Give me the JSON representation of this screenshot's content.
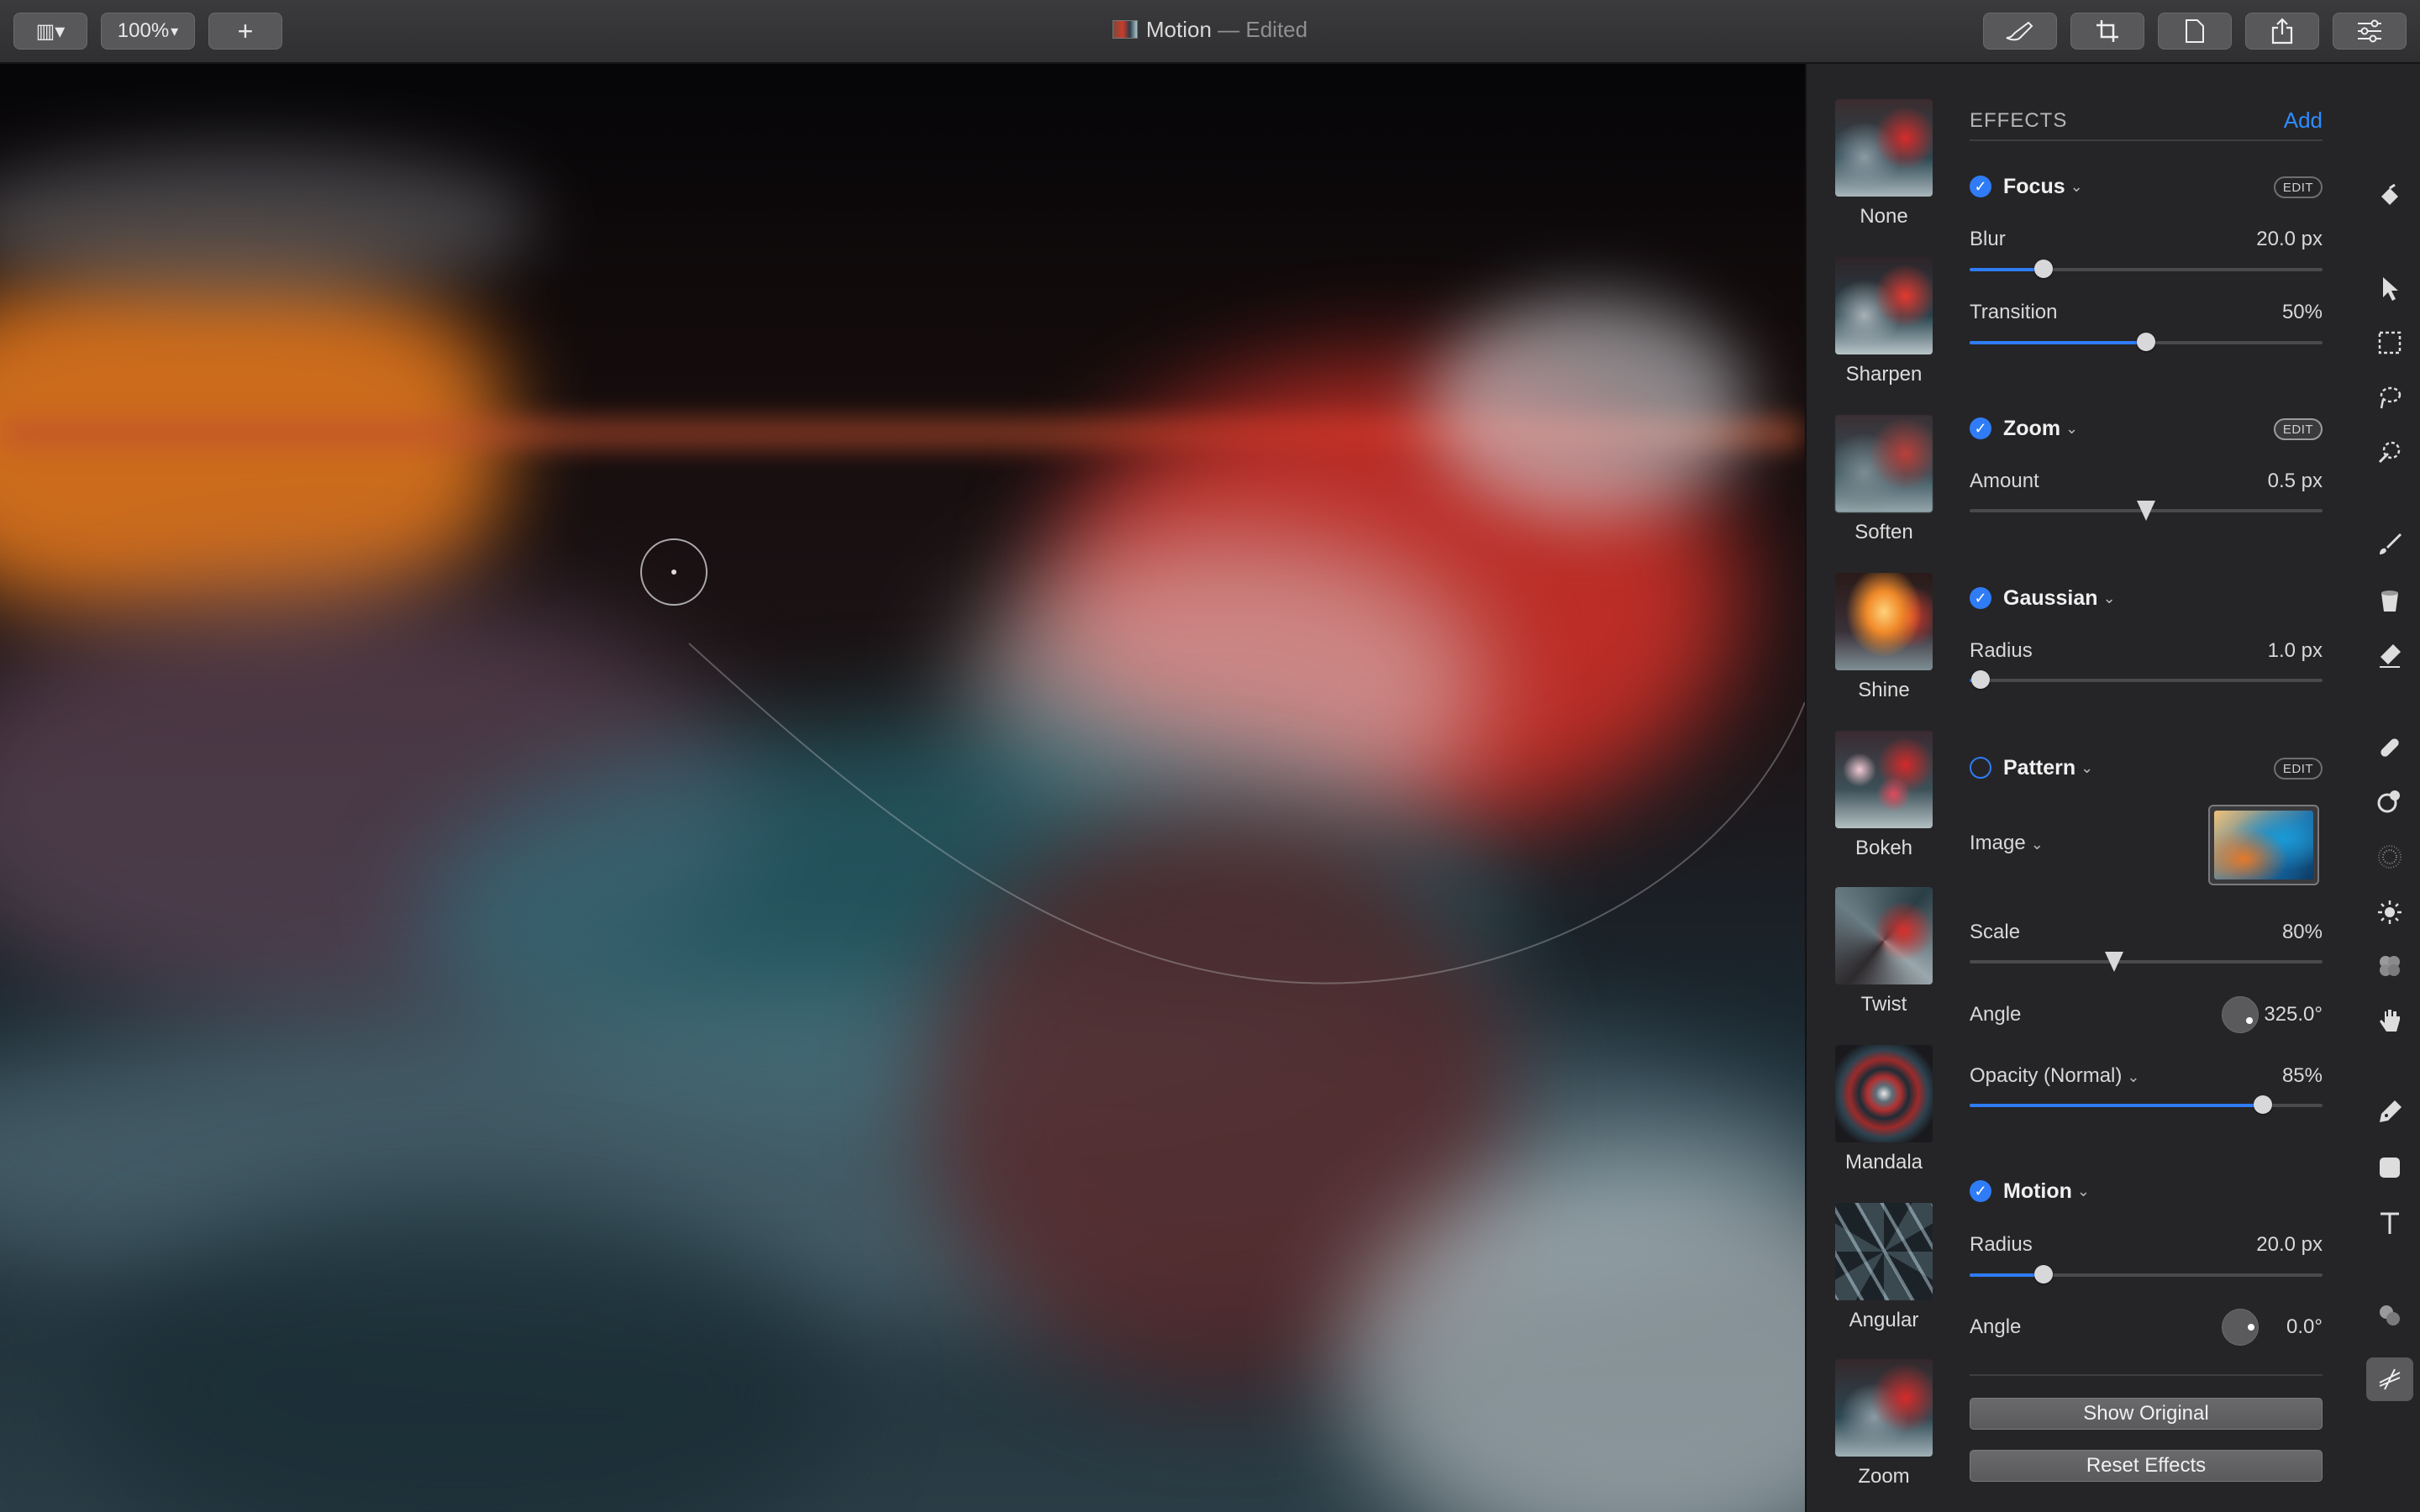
{
  "toolbar": {
    "zoom": "100%",
    "add": "+",
    "title": "Motion",
    "status": " — Edited",
    "sidebar_toggle": "▥▾",
    "zoom_chevron": "▾",
    "icons": [
      "brush-icon",
      "crop-icon",
      "document-icon",
      "share-icon",
      "adjust-icon"
    ]
  },
  "presets": [
    {
      "label": "None"
    },
    {
      "label": "Sharpen"
    },
    {
      "label": "Soften"
    },
    {
      "label": "Shine"
    },
    {
      "label": "Bokeh"
    },
    {
      "label": "Twist"
    },
    {
      "label": "Mandala"
    },
    {
      "label": "Angular"
    },
    {
      "label": "Zoom"
    }
  ],
  "effects": {
    "header": "EFFECTS",
    "add": "Add",
    "edit": "EDIT",
    "focus": {
      "name": "Focus",
      "enabled": true,
      "blur_label": "Blur",
      "blur_value": "20.0 px",
      "blur_fraction": 0.21,
      "transition_label": "Transition",
      "transition_value": "50%",
      "transition_fraction": 0.5
    },
    "zoom": {
      "name": "Zoom",
      "enabled": true,
      "amount_label": "Amount",
      "amount_value": "0.5 px",
      "amount_fraction": 0.5
    },
    "gaussian": {
      "name": "Gaussian",
      "enabled": true,
      "radius_label": "Radius",
      "radius_value": "1.0 px",
      "radius_fraction": 0.03
    },
    "pattern": {
      "name": "Pattern",
      "enabled": false,
      "image_label": "Image",
      "scale_label": "Scale",
      "scale_value": "80%",
      "scale_fraction": 0.41,
      "angle_label": "Angle",
      "angle_value": "325.0°",
      "opacity_label": "Opacity (Normal)",
      "opacity_value": "85%",
      "opacity_fraction": 0.83
    },
    "motion": {
      "name": "Motion",
      "enabled": true,
      "radius_label": "Radius",
      "radius_value": "20.0 px",
      "radius_fraction": 0.21,
      "angle_label": "Angle",
      "angle_value": "0.0°"
    },
    "show_original": "Show Original",
    "reset": "Reset Effects"
  },
  "tools": [
    "paint-bucket-icon",
    "arrow-pointer-icon",
    "rect-select-icon",
    "lasso-icon",
    "magic-wand-icon",
    "brush-icon",
    "bucket-icon",
    "eraser-icon",
    "bandage-icon",
    "clone-icon",
    "noise-icon",
    "sun-icon",
    "flowers-icon",
    "smudge-icon",
    "pen-icon",
    "shape-icon",
    "text-icon",
    "layers-icon",
    "effects-icon"
  ],
  "colors": {
    "accent": "#2f7cf6",
    "link": "#2f8cff"
  }
}
